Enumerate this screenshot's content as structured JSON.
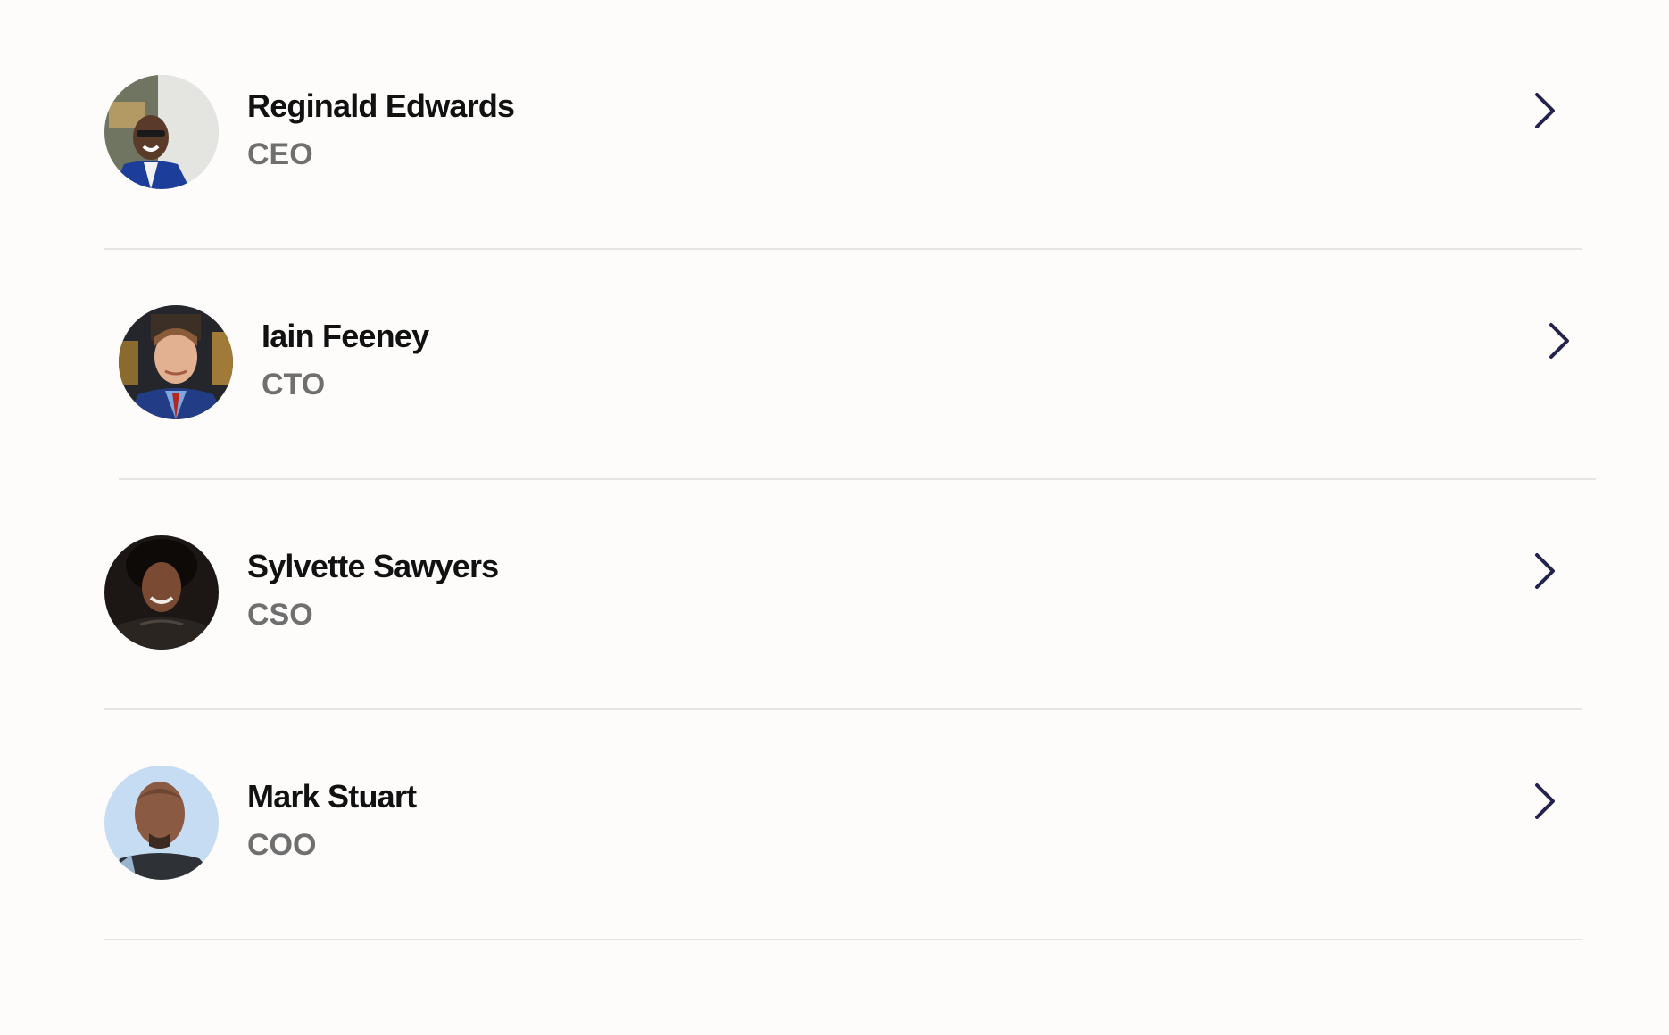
{
  "team": {
    "members": [
      {
        "name": "Reginald Edwards",
        "role": "CEO"
      },
      {
        "name": "Iain Feeney",
        "role": "CTO"
      },
      {
        "name": "Sylvette Sawyers",
        "role": "CSO"
      },
      {
        "name": "Mark Stuart",
        "role": "COO"
      }
    ]
  },
  "colors": {
    "background": "#fdfcfa",
    "name_text": "#111111",
    "role_text": "#6f6f6f",
    "chevron": "#23234f",
    "divider": "#e6e5e2"
  },
  "icons": {
    "row_action": "chevron-right-icon"
  }
}
